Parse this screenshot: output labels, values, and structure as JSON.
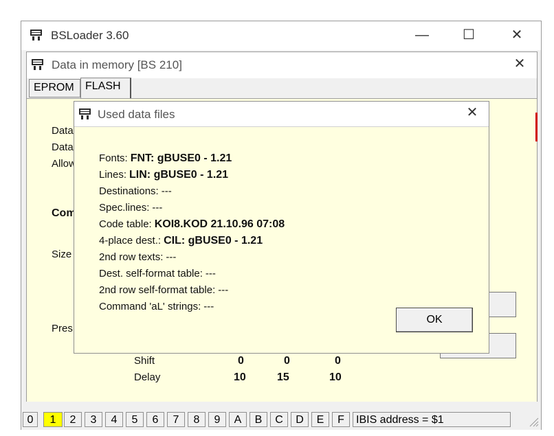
{
  "main": {
    "title": "BSLoader 3.60"
  },
  "child": {
    "title": "Data in memory [BS 210]"
  },
  "tabs": [
    {
      "label": "EPROM"
    },
    {
      "label": "FLASH"
    }
  ],
  "background": {
    "labels": [
      "Data",
      "Data",
      "Allow",
      "Com",
      "Size",
      "Pres"
    ],
    "table": [
      {
        "label": "Shift",
        "values": [
          "0",
          "0",
          "0"
        ]
      },
      {
        "label": "Delay",
        "values": [
          "10",
          "15",
          "10"
        ]
      }
    ]
  },
  "dialog": {
    "title": "Used data files",
    "rows": [
      {
        "label": "Fonts:",
        "value": "FNT: gBUSE0 - 1.21"
      },
      {
        "label": "Lines:",
        "value": "LIN: gBUSE0 - 1.21"
      },
      {
        "label": "Destinations:",
        "value": "---"
      },
      {
        "label": "Spec.lines:",
        "value": "---"
      },
      {
        "label": "Code table:",
        "value": "KOI8.KOD 21.10.96 07:08"
      },
      {
        "label": "4-place dest.:",
        "value": "CIL: gBUSE0 - 1.21"
      },
      {
        "label": "2nd row texts:",
        "value": "---"
      },
      {
        "label": "Dest. self-format table:",
        "value": "---"
      },
      {
        "label": "2nd row self-format table:",
        "value": "---"
      },
      {
        "label": "Command 'aL' strings:",
        "value": "---"
      }
    ],
    "ok_label": "OK"
  },
  "statusbar": {
    "cells": [
      "0",
      "1",
      "2",
      "3",
      "4",
      "5",
      "6",
      "7",
      "8",
      "9",
      "A",
      "B",
      "C",
      "D",
      "E",
      "F"
    ],
    "selected": "1",
    "selected_color": "#ffff00",
    "ibis": "IBIS address = $1"
  }
}
